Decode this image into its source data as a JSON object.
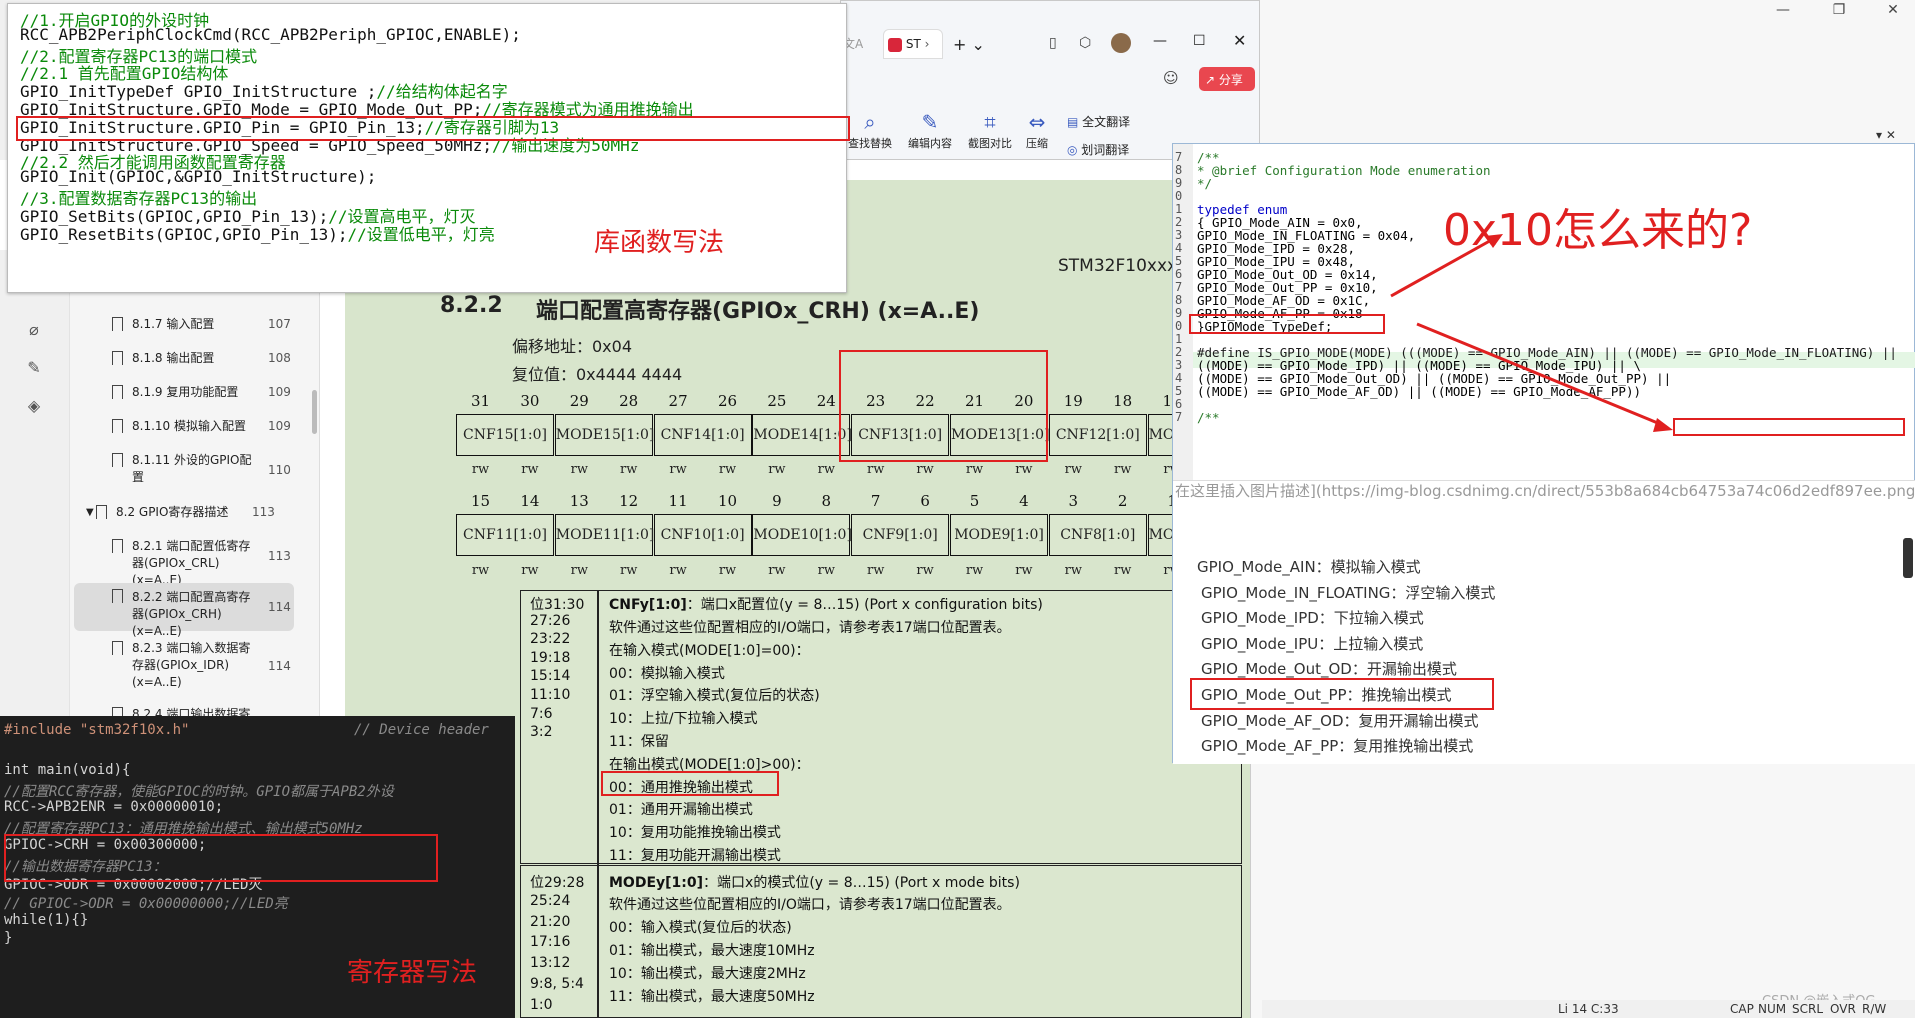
{
  "outer": {
    "controls": [
      "—",
      "❐",
      "✕"
    ],
    "statusbar": {
      "cursor": "Li 14 C:33",
      "caps": "CAP",
      "num": "NUM",
      "scrl": "SCRL",
      "ovr": "OVR",
      "rw": "R/W"
    }
  },
  "browser": {
    "tab_label": "ST",
    "tab_faded": "文A",
    "share_label": "分享",
    "tools": [
      "查找替换",
      "编辑内容",
      "截图对比",
      "压缩",
      "全文翻译",
      "划词翻译"
    ]
  },
  "code_lib": {
    "lines": [
      {
        "text": "//1.开启GPIO的外设时钟",
        "comment": true
      },
      {
        "text": "RCC_APB2PeriphClockCmd(RCC_APB2Periph_GPIOC,ENABLE);",
        "comment": false
      },
      {
        "text": "//2.配置寄存器PC13的端口模式",
        "comment": true
      },
      {
        "text": "//2.1 首先配置GPIO结构体",
        "comment": true
      },
      {
        "text": "GPIO_InitTypeDef GPIO_InitStructure ;",
        "tail": "//给结构体起名字"
      },
      {
        "text": "GPIO_InitStructure.GPIO_Mode = GPIO_Mode_Out_PP;",
        "tail": "//寄存器模式为通用推挽输出"
      },
      {
        "text": "GPIO_InitStructure.GPIO_Pin = GPIO_Pin_13;",
        "tail": "//寄存器引脚为13"
      },
      {
        "text": "GPIO_InitStructure.GPIO_Speed = GPIO_Speed_50MHz;",
        "tail": "//输出速度为50MHz"
      },
      {
        "text": "//2.2 然后才能调用函数配置寄存器",
        "comment": true
      },
      {
        "text": "GPIO_Init(GPIOC,&GPIO_InitStructure);",
        "comment": false
      },
      {
        "text": "//3.配置数据寄存器PC13的输出",
        "comment": true
      },
      {
        "text": "GPIO_SetBits(GPIOC,GPIO_Pin_13);",
        "tail": "//设置高电平，灯灭"
      },
      {
        "text": "GPIO_ResetBits(GPIOC,GPIO_Pin_13);",
        "tail": "//设置低电平，灯亮"
      }
    ],
    "annotation": "库函数写法"
  },
  "toc": {
    "items": [
      {
        "label": "8.1.7 输入配置",
        "page": "107"
      },
      {
        "label": "8.1.8 输出配置",
        "page": "108"
      },
      {
        "label": "8.1.9 复用功能配置",
        "page": "109"
      },
      {
        "label": "8.1.10 模拟输入配置",
        "page": "109"
      },
      {
        "label": "8.1.11 外设的GPIO配置",
        "page": "110"
      },
      {
        "label": "8.2 GPIO寄存器描述",
        "page": "113"
      },
      {
        "label": "8.2.1 端口配置低寄存器(GPIOx_CRL) (x=A..E)",
        "page": "113"
      },
      {
        "label": "8.2.2 端口配置高寄存器(GPIOx_CRH) (x=A..E)",
        "page": "114"
      },
      {
        "label": "8.2.3 端口输入数据寄存器(GPIOx_IDR) (x=A..E)",
        "page": "114"
      },
      {
        "label": "8.2.4 端口输出数据寄存",
        "page": ""
      }
    ]
  },
  "pdf": {
    "header_right": "STM32F10xxx",
    "section_num": "8.2.2",
    "section_title": "端口配置高寄存器(GPIOx_CRH) (x=A..E)",
    "offset": "偏移地址：0x04",
    "reset": "复位值：0x4444 4444",
    "bits_top": [
      "31",
      "30",
      "29",
      "28",
      "27",
      "26",
      "25",
      "24",
      "23",
      "22",
      "21",
      "20",
      "19",
      "18",
      "17"
    ],
    "fields_top": [
      "CNF15[1:0]",
      "MODE15[1:0]",
      "CNF14[1:0]",
      "MODE14[1:0]",
      "CNF13[1:0]",
      "MODE13[1:0]",
      "CNF12[1:0]",
      "MODE"
    ],
    "bits_bottom": [
      "15",
      "14",
      "13",
      "12",
      "11",
      "10",
      "9",
      "8",
      "7",
      "6",
      "5",
      "4",
      "3",
      "2",
      "1"
    ],
    "fields_bottom": [
      "CNF11[1:0]",
      "MODE11[1:0]",
      "CNF10[1:0]",
      "MODE10[1:0]",
      "CNF9[1:0]",
      "MODE9[1:0]",
      "CNF8[1:0]",
      "MODE"
    ],
    "rw": "rw",
    "cnf_bits": [
      "位31:30",
      "27:26",
      "23:22",
      "19:18",
      "15:14",
      "11:10",
      "7:6",
      "3:2"
    ],
    "cnf_title": "CNFy[1:0]",
    "cnf_title_rest": "：端口x配置位(y = 8…15) (Port x configuration bits)",
    "cnf_lines": [
      "软件通过这些位配置相应的I/O端口，请参考表17端口位配置表。",
      "在输入模式(MODE[1:0]=00)：",
      "00：模拟输入模式",
      "01：浮空输入模式(复位后的状态)",
      "10：上拉/下拉输入模式",
      "11：保留",
      "在输出模式(MODE[1:0]>00)：",
      "00：通用推挽输出模式",
      "01：通用开漏输出模式",
      "10：复用功能推挽输出模式",
      "11：复用功能开漏输出模式"
    ],
    "mode_bits": [
      "位29:28",
      "25:24",
      "21:20",
      "17:16",
      "13:12",
      "9:8, 5:4",
      "1:0"
    ],
    "mode_title": "MODEy[1:0]",
    "mode_title_rest": "：端口x的模式位(y = 8…15) (Port x mode bits)",
    "mode_lines": [
      "软件通过这些位配置相应的I/O端口，请参考表17端口位配置表。",
      "00：输入模式(复位后的状态)",
      "01：输出模式，最大速度10MHz",
      "10：输出模式，最大速度2MHz",
      "11：输出模式，最大速度50MHz"
    ]
  },
  "code_reg": {
    "include": "#include \"stm32f10x.h\"",
    "include_comment": "// Device header",
    "lines": [
      {
        "text": "int main(void){",
        "kind": "code"
      },
      {
        "text": "  //配置RCC寄存器，使能GPIOC的时钟。GPIO都属于APB2外设",
        "kind": "comment"
      },
      {
        "text": "  RCC->APB2ENR = 0x00000010;",
        "kind": "code"
      },
      {
        "text": "  //配置寄存器PC13：通用推挽输出模式、输出模式50MHz",
        "kind": "comment"
      },
      {
        "text": "  GPIOC->CRH = 0x00300000;",
        "kind": "code"
      },
      {
        "text": "  //输出数据寄存器PC13：",
        "kind": "comment"
      },
      {
        "text": "  GPIOC->ODR = 0x00002000;//LED灭",
        "kind": "code"
      },
      {
        "text": "//  GPIOC->ODR = 0x00000000;//LED亮",
        "kind": "comment"
      },
      {
        "text": "  while(1){}",
        "kind": "code"
      },
      {
        "text": "}",
        "kind": "code"
      }
    ],
    "annotation": "寄存器写法"
  },
  "code_right": {
    "line_numbers": [
      "7",
      "8",
      "9",
      "0",
      "1",
      "2",
      "3",
      "4",
      "5",
      "6",
      "7",
      "8",
      "9",
      "0",
      "1",
      "2",
      "3",
      "4",
      "5",
      "6",
      "7"
    ],
    "lines": [
      "/**",
      "  * @brief  Configuration Mode enumeration",
      "  */",
      "",
      "typedef enum",
      "{ GPIO_Mode_AIN = 0x0,",
      "  GPIO_Mode_IN_FLOATING = 0x04,",
      "  GPIO_Mode_IPD = 0x28,",
      "  GPIO_Mode_IPU = 0x48,",
      "  GPIO_Mode_Out_OD = 0x14,",
      "  GPIO_Mode_Out_PP = 0x10,",
      "  GPIO_Mode_AF_OD = 0x1C,",
      "  GPIO_Mode_AF_PP = 0x18",
      "}GPIOMode_TypeDef;",
      "",
      "#define IS_GPIO_MODE(MODE) (((MODE) == GPIO_Mode_AIN) || ((MODE) == GPIO_Mode_IN_FLOATING) ||",
      "                           ((MODE) == GPIO_Mode_IPD) || ((MODE) == GPIO_Mode_IPU) || \\",
      "                           ((MODE) == GPIO_Mode_Out_OD) || ((MODE) == GPIO_Mode_Out_PP) ||",
      "                           ((MODE) == GPIO_Mode_AF_OD) || ((MODE) == GPIO_Mode_AF_PP))",
      "",
      "/**"
    ],
    "question": "0x10怎么来的?",
    "img_placeholder": "在这里插入图片描述](https://img-blog.csdnimg.cn/direct/553b8a684cb64753a74c06d2edf897ee.png)",
    "enum_desc": [
      "GPIO_Mode_AIN：模拟输入模式",
      "GPIO_Mode_IN_FLOATING：浮空输入模式",
      "GPIO_Mode_IPD：下拉输入模式",
      "GPIO_Mode_IPU：上拉输入模式",
      "GPIO_Mode_Out_OD：开漏输出模式",
      "GPIO_Mode_Out_PP：推挽输出模式",
      "GPIO_Mode_AF_OD：复用开漏输出模式",
      "GPIO_Mode_AF_PP：复用推挽输出模式"
    ]
  },
  "watermark": "CSDN @嵌入式OG",
  "colors": {
    "annotation_red": "#e02020",
    "page_green": "#dbe7cf",
    "editor_dark": "#1e1e1e"
  }
}
